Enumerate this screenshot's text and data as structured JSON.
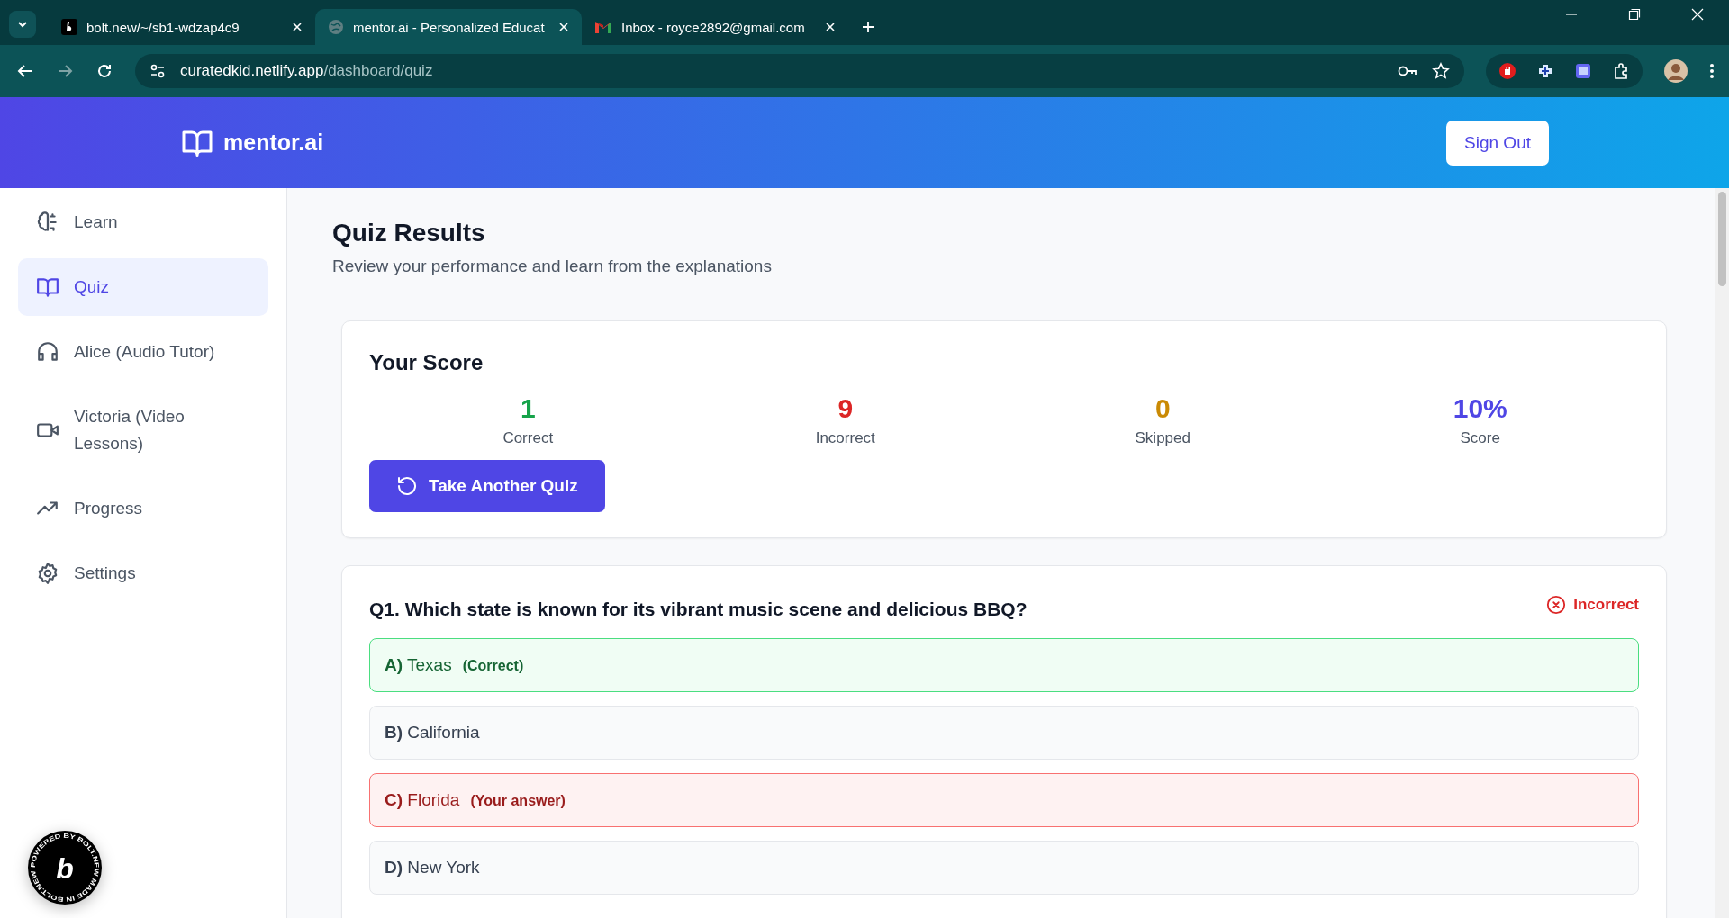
{
  "browser": {
    "tabs": [
      {
        "title": "bolt.new/~/sb1-wdzap4c9",
        "selected": false,
        "kind": "bolt"
      },
      {
        "title": "mentor.ai - Personalized Educat",
        "selected": true,
        "kind": "globe"
      },
      {
        "title": "Inbox - royce2892@gmail.com",
        "selected": false,
        "kind": "mail"
      }
    ],
    "url": {
      "host": "curatedkid.netlify.app",
      "path": "/dashboard/quiz"
    }
  },
  "header": {
    "brand": "mentor.ai",
    "sign_out": "Sign Out"
  },
  "sidebar": {
    "items": [
      {
        "label": "Learn",
        "selected": false
      },
      {
        "label": "Quiz",
        "selected": true
      },
      {
        "label": "Alice (Audio Tutor)",
        "selected": false
      },
      {
        "label": "Victoria (Video Lessons)",
        "selected": false
      },
      {
        "label": "Progress",
        "selected": false
      },
      {
        "label": "Settings",
        "selected": false
      }
    ]
  },
  "page": {
    "title": "Quiz Results",
    "subtitle": "Review your performance and learn from the explanations"
  },
  "score": {
    "title": "Your Score",
    "stats": [
      {
        "value": "1",
        "label": "Correct",
        "color": "#16a34a"
      },
      {
        "value": "9",
        "label": "Incorrect",
        "color": "#dc2626"
      },
      {
        "value": "0",
        "label": "Skipped",
        "color": "#ca8a04"
      },
      {
        "value": "10%",
        "label": "Score",
        "color": "#4f46e5"
      }
    ],
    "button": "Take Another Quiz"
  },
  "question": {
    "text": "Q1. Which state is known for its vibrant music scene and delicious BBQ?",
    "status": "Incorrect",
    "options": [
      {
        "letter": "A)",
        "text": "Texas",
        "note": "(Correct)",
        "kind": "correct"
      },
      {
        "letter": "B)",
        "text": "California",
        "kind": "plain"
      },
      {
        "letter": "C)",
        "text": "Florida",
        "note": "(Your answer)",
        "kind": "wrong"
      },
      {
        "letter": "D)",
        "text": "New York",
        "kind": "plain"
      }
    ]
  },
  "badge": {
    "ring": "POWERED BY BOLT.NEW MADE IN BOLT.NEW ",
    "letter": "b"
  }
}
